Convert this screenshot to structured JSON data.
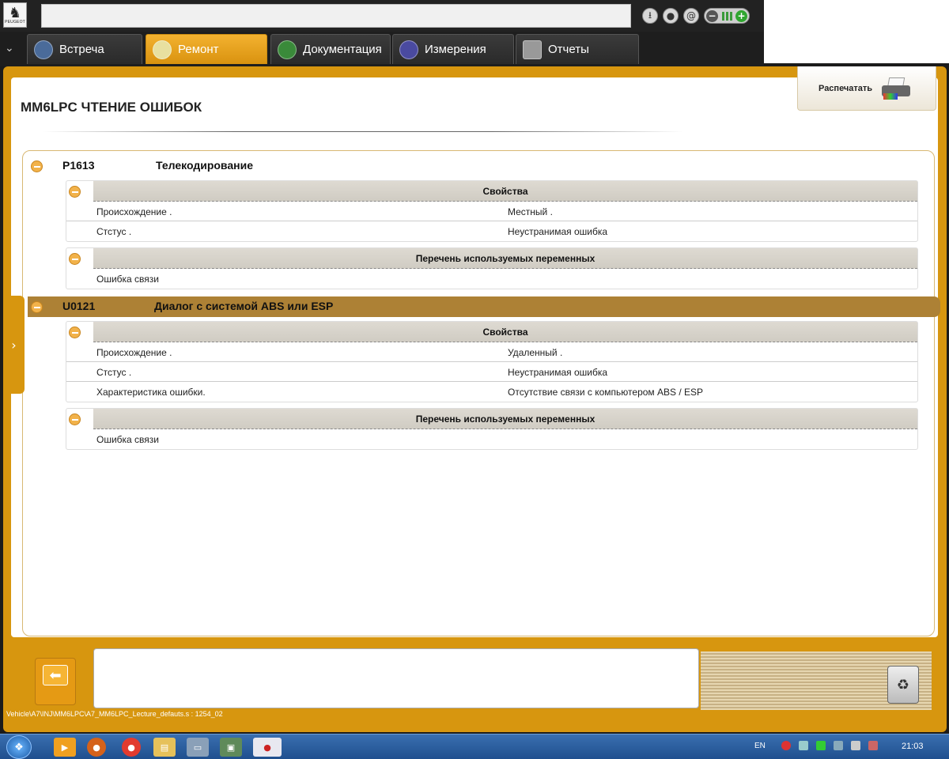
{
  "header": {
    "logo_text": "PEUGEOT",
    "sys_icons": [
      "download-icon",
      "lock-icon",
      "at-icon"
    ],
    "battery_icon": "battery-icon"
  },
  "tabs": [
    {
      "label": "Встреча",
      "icon": "globe-icon",
      "color": "#4a6b9a"
    },
    {
      "label": "Ремонт",
      "icon": "magnifier-icon",
      "color": "#e8e0a0",
      "active": true
    },
    {
      "label": "Документация",
      "icon": "book-icon",
      "color": "#3a8a3a"
    },
    {
      "label": "Измерения",
      "icon": "wave-icon",
      "color": "#4a4aa0"
    },
    {
      "label": "Отчеты",
      "icon": "document-icon",
      "color": "#999999"
    }
  ],
  "page": {
    "title": "MM6LPC  ЧТЕНИЕ ОШИБОК",
    "print_label": "Распечатать"
  },
  "faults": [
    {
      "code": "P1613",
      "description": "Телекодирование",
      "properties_title": "Свойства",
      "properties": [
        {
          "key": "Происхождение .",
          "value": "Местный ."
        },
        {
          "key": "Стстус .",
          "value": "Неустранимая ошибка"
        }
      ],
      "variables_title": "Перечень используемых переменных",
      "variables": [
        "Ошибка связи"
      ]
    },
    {
      "code": "U0121",
      "description": "Диалог с системой ABS или ESP",
      "selected": true,
      "properties_title": "Свойства",
      "properties": [
        {
          "key": "Происхождение .",
          "value": "Удаленный ."
        },
        {
          "key": "Стстус .",
          "value": "Неустранимая ошибка"
        },
        {
          "key": "Характеристика ошибки.",
          "value": "Отсутствие связи с компьютером ABS / ESP"
        }
      ],
      "variables_title": "Перечень используемых переменных",
      "variables": [
        "Ошибка связи"
      ]
    }
  ],
  "bottom": {
    "path": "Vehicle\\A7\\INJ\\MM6LPC\\A7_MM6LPC_Lecture_defauts.s : 1254_02"
  },
  "taskbar": {
    "lang": "EN",
    "time": "21:03"
  },
  "colors": {
    "accent": "#d7960f",
    "selected_row": "#ad8135"
  }
}
